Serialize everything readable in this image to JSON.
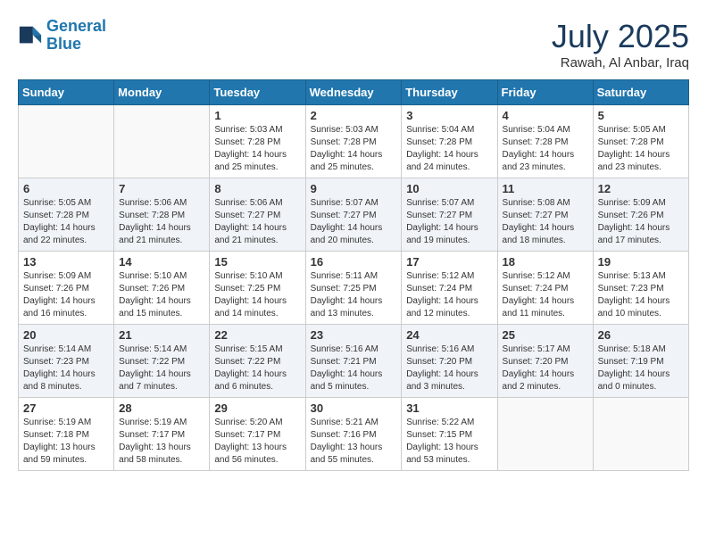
{
  "header": {
    "logo_line1": "General",
    "logo_line2": "Blue",
    "month": "July 2025",
    "location": "Rawah, Al Anbar, Iraq"
  },
  "days_of_week": [
    "Sunday",
    "Monday",
    "Tuesday",
    "Wednesday",
    "Thursday",
    "Friday",
    "Saturday"
  ],
  "weeks": [
    [
      {
        "day": "",
        "info": ""
      },
      {
        "day": "",
        "info": ""
      },
      {
        "day": "1",
        "info": "Sunrise: 5:03 AM\nSunset: 7:28 PM\nDaylight: 14 hours and 25 minutes."
      },
      {
        "day": "2",
        "info": "Sunrise: 5:03 AM\nSunset: 7:28 PM\nDaylight: 14 hours and 25 minutes."
      },
      {
        "day": "3",
        "info": "Sunrise: 5:04 AM\nSunset: 7:28 PM\nDaylight: 14 hours and 24 minutes."
      },
      {
        "day": "4",
        "info": "Sunrise: 5:04 AM\nSunset: 7:28 PM\nDaylight: 14 hours and 23 minutes."
      },
      {
        "day": "5",
        "info": "Sunrise: 5:05 AM\nSunset: 7:28 PM\nDaylight: 14 hours and 23 minutes."
      }
    ],
    [
      {
        "day": "6",
        "info": "Sunrise: 5:05 AM\nSunset: 7:28 PM\nDaylight: 14 hours and 22 minutes."
      },
      {
        "day": "7",
        "info": "Sunrise: 5:06 AM\nSunset: 7:28 PM\nDaylight: 14 hours and 21 minutes."
      },
      {
        "day": "8",
        "info": "Sunrise: 5:06 AM\nSunset: 7:27 PM\nDaylight: 14 hours and 21 minutes."
      },
      {
        "day": "9",
        "info": "Sunrise: 5:07 AM\nSunset: 7:27 PM\nDaylight: 14 hours and 20 minutes."
      },
      {
        "day": "10",
        "info": "Sunrise: 5:07 AM\nSunset: 7:27 PM\nDaylight: 14 hours and 19 minutes."
      },
      {
        "day": "11",
        "info": "Sunrise: 5:08 AM\nSunset: 7:27 PM\nDaylight: 14 hours and 18 minutes."
      },
      {
        "day": "12",
        "info": "Sunrise: 5:09 AM\nSunset: 7:26 PM\nDaylight: 14 hours and 17 minutes."
      }
    ],
    [
      {
        "day": "13",
        "info": "Sunrise: 5:09 AM\nSunset: 7:26 PM\nDaylight: 14 hours and 16 minutes."
      },
      {
        "day": "14",
        "info": "Sunrise: 5:10 AM\nSunset: 7:26 PM\nDaylight: 14 hours and 15 minutes."
      },
      {
        "day": "15",
        "info": "Sunrise: 5:10 AM\nSunset: 7:25 PM\nDaylight: 14 hours and 14 minutes."
      },
      {
        "day": "16",
        "info": "Sunrise: 5:11 AM\nSunset: 7:25 PM\nDaylight: 14 hours and 13 minutes."
      },
      {
        "day": "17",
        "info": "Sunrise: 5:12 AM\nSunset: 7:24 PM\nDaylight: 14 hours and 12 minutes."
      },
      {
        "day": "18",
        "info": "Sunrise: 5:12 AM\nSunset: 7:24 PM\nDaylight: 14 hours and 11 minutes."
      },
      {
        "day": "19",
        "info": "Sunrise: 5:13 AM\nSunset: 7:23 PM\nDaylight: 14 hours and 10 minutes."
      }
    ],
    [
      {
        "day": "20",
        "info": "Sunrise: 5:14 AM\nSunset: 7:23 PM\nDaylight: 14 hours and 8 minutes."
      },
      {
        "day": "21",
        "info": "Sunrise: 5:14 AM\nSunset: 7:22 PM\nDaylight: 14 hours and 7 minutes."
      },
      {
        "day": "22",
        "info": "Sunrise: 5:15 AM\nSunset: 7:22 PM\nDaylight: 14 hours and 6 minutes."
      },
      {
        "day": "23",
        "info": "Sunrise: 5:16 AM\nSunset: 7:21 PM\nDaylight: 14 hours and 5 minutes."
      },
      {
        "day": "24",
        "info": "Sunrise: 5:16 AM\nSunset: 7:20 PM\nDaylight: 14 hours and 3 minutes."
      },
      {
        "day": "25",
        "info": "Sunrise: 5:17 AM\nSunset: 7:20 PM\nDaylight: 14 hours and 2 minutes."
      },
      {
        "day": "26",
        "info": "Sunrise: 5:18 AM\nSunset: 7:19 PM\nDaylight: 14 hours and 0 minutes."
      }
    ],
    [
      {
        "day": "27",
        "info": "Sunrise: 5:19 AM\nSunset: 7:18 PM\nDaylight: 13 hours and 59 minutes."
      },
      {
        "day": "28",
        "info": "Sunrise: 5:19 AM\nSunset: 7:17 PM\nDaylight: 13 hours and 58 minutes."
      },
      {
        "day": "29",
        "info": "Sunrise: 5:20 AM\nSunset: 7:17 PM\nDaylight: 13 hours and 56 minutes."
      },
      {
        "day": "30",
        "info": "Sunrise: 5:21 AM\nSunset: 7:16 PM\nDaylight: 13 hours and 55 minutes."
      },
      {
        "day": "31",
        "info": "Sunrise: 5:22 AM\nSunset: 7:15 PM\nDaylight: 13 hours and 53 minutes."
      },
      {
        "day": "",
        "info": ""
      },
      {
        "day": "",
        "info": ""
      }
    ]
  ]
}
